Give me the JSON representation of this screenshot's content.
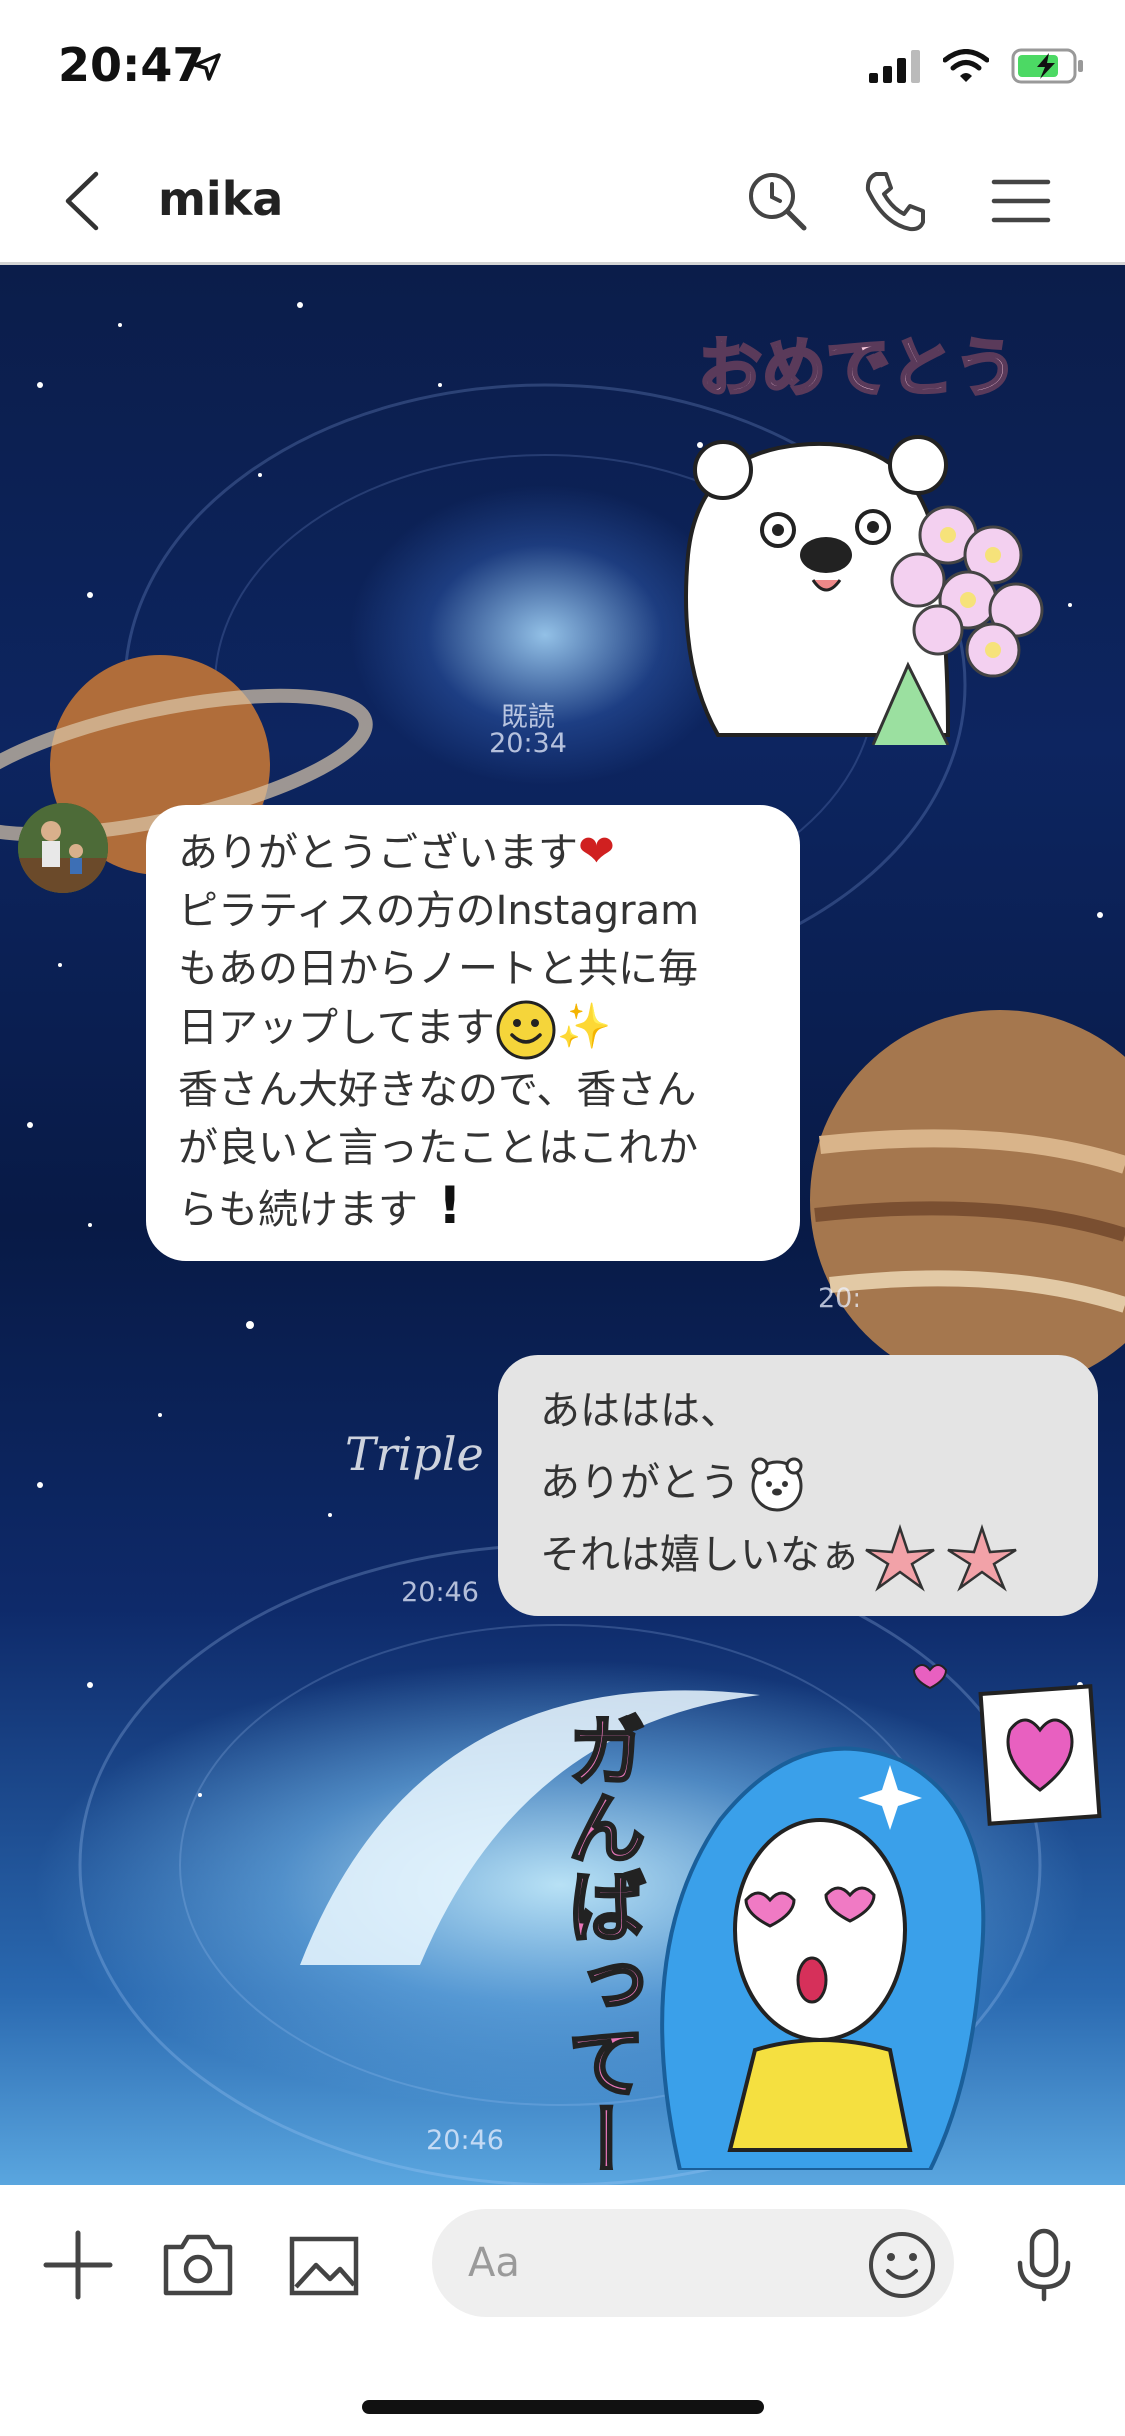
{
  "status": {
    "time": "20:47"
  },
  "header": {
    "title": "mika"
  },
  "messages": {
    "sent_sticker_text": "おめでとう",
    "read_label": "既読",
    "sent_time_1": "20:34",
    "received": {
      "lines": [
        "ありがとうございます",
        "ピラティスの方のInstagram",
        "もあの日からノートと共に毎",
        "日アップしてます",
        "香さん大好きなので、香さん",
        "が良いと言ったことはこれか",
        "らも続けます"
      ],
      "time_partial": "20:"
    },
    "reply": {
      "lines": [
        "あははは、",
        "ありがとう",
        "それは嬉しいなぁ"
      ],
      "time": "20:46"
    },
    "sticker2_text": "ガんばってー",
    "sent_time_2": "20:46"
  },
  "background": {
    "caption": "Triple S"
  },
  "input": {
    "placeholder": "Aa"
  },
  "colors": {
    "bubble_left": "#ffffff",
    "bubble_right": "#e4e4e4",
    "accent": "#d02020"
  }
}
